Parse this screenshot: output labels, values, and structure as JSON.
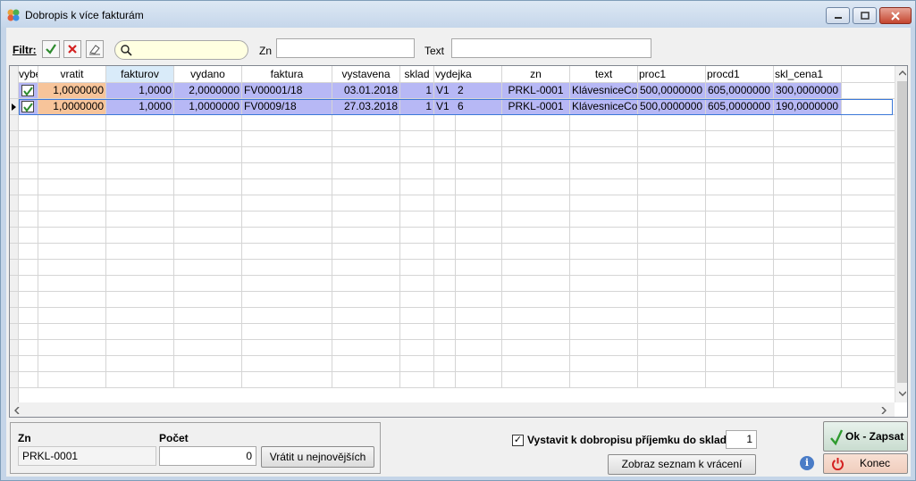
{
  "window": {
    "title": "Dobropis k více fakturám"
  },
  "filter": {
    "label": "Filtr:",
    "search_placeholder": "",
    "zn_label": "Zn",
    "zn_value": "",
    "text_label": "Text",
    "text_value": ""
  },
  "grid": {
    "columns": [
      "vybe",
      "vratit",
      "fakturov",
      "vydano",
      "faktura",
      "vystavena",
      "sklad",
      "vydejka",
      "zn",
      "text",
      "proc1",
      "procd1",
      "skl_cena1"
    ],
    "rows": [
      {
        "checked": true,
        "vratit": "1,0000000",
        "fakturov": "1,0000",
        "vydano": "2,0000000",
        "faktura": "FV00001/18",
        "vystavena": "03.01.2018",
        "sklad": "1",
        "vydejka_a": "V1",
        "vydejka_b": "2",
        "zn": "PRKL-0001",
        "text": "KlávesniceCo",
        "proc1": "500,0000000",
        "procd1": "605,0000000",
        "skl_cena1": "300,0000000"
      },
      {
        "checked": true,
        "vratit": "1,0000000",
        "fakturov": "1,0000",
        "vydano": "1,0000000",
        "faktura": "FV0009/18",
        "vystavena": "27.03.2018",
        "sklad": "1",
        "vydejka_a": "V1",
        "vydejka_b": "6",
        "zn": "PRKL-0001",
        "text": "KlávesniceCo",
        "proc1": "500,0000000",
        "procd1": "605,0000000",
        "skl_cena1": "190,0000000"
      }
    ]
  },
  "bottom": {
    "zn_label": "Zn",
    "zn_value": "PRKL-0001",
    "pocet_label": "Počet",
    "pocet_value": "0",
    "vratit_button": "Vrátit u nejnovějších",
    "vystavit_label": "Vystavit k dobropisu příjemku do skladu",
    "vystavit_checked": "✓",
    "sklad_value": "1",
    "zobraz_button": "Zobraz seznam k vrácení",
    "ok_button": "Ok - Zapsat",
    "konec_button": "Konec",
    "info_icon": "i"
  },
  "colors": {
    "selected_row": "#b7b8f5",
    "vratit_cell": "#f7c49a",
    "row_select_border": "#3b78d8"
  }
}
